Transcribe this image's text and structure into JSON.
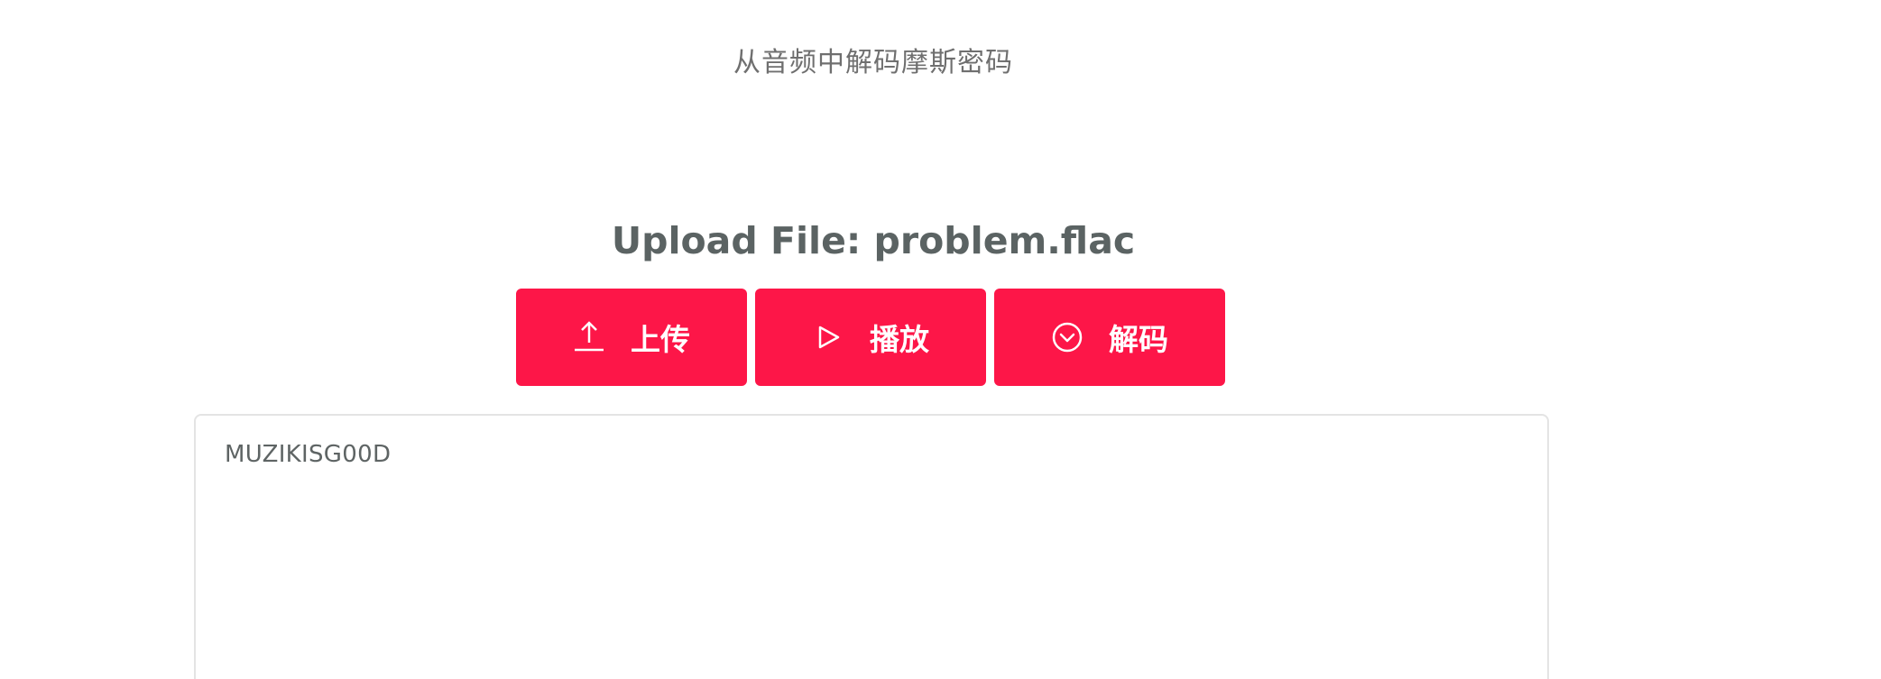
{
  "page": {
    "title": "从音频中解码摩斯密码"
  },
  "upload": {
    "heading": "Upload File: problem.flac"
  },
  "toolbar": {
    "upload_label": "上传",
    "upload_icon": "upload-arrow-icon",
    "play_label": "播放",
    "play_icon": "play-triangle-icon",
    "decode_label": "解码",
    "decode_icon": "chevron-circle-down-icon"
  },
  "output": {
    "text": "MUZIKISG00D"
  },
  "colors": {
    "accent": "#fd1648",
    "heading": "#5b6363",
    "title": "#6f6f6f",
    "border": "#e4e4e4"
  }
}
